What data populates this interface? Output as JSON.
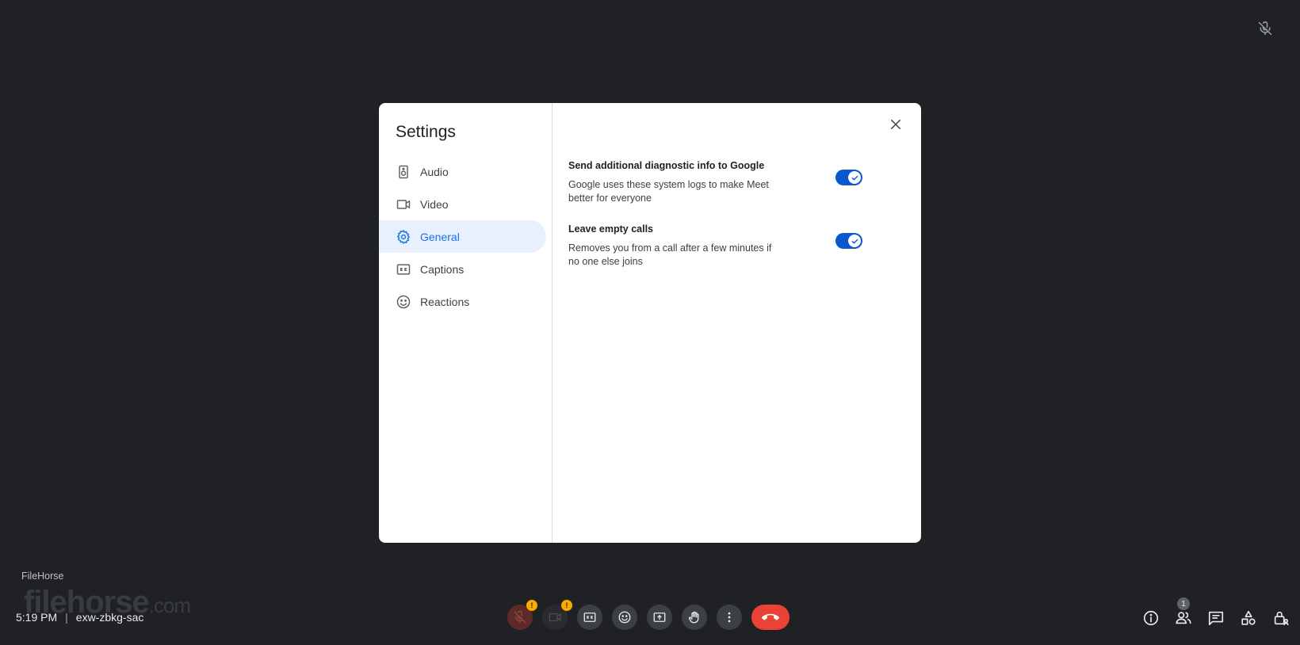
{
  "settings_dialog": {
    "title": "Settings",
    "nav": [
      {
        "label": "Audio",
        "icon": "speaker-icon",
        "active": false
      },
      {
        "label": "Video",
        "icon": "videocam-icon",
        "active": false
      },
      {
        "label": "General",
        "icon": "gear-icon",
        "active": true
      },
      {
        "label": "Captions",
        "icon": "closed-caption-icon",
        "active": false
      },
      {
        "label": "Reactions",
        "icon": "smiley-icon",
        "active": false
      }
    ],
    "settings": [
      {
        "title": "Send additional diagnostic info to Google",
        "description": "Google uses these system logs to make Meet better for everyone",
        "enabled": true
      },
      {
        "title": "Leave empty calls",
        "description": "Removes you from a call after a few minutes if no one else joins",
        "enabled": true
      }
    ]
  },
  "watermark": {
    "label": "FileHorse",
    "logo_main": "filehorse",
    "logo_suffix": ".com"
  },
  "meeting": {
    "time": "5:19 PM",
    "separator": "|",
    "code": "exw-zbkg-sac"
  },
  "controls": {
    "mic_warning": "!",
    "camera_warning": "!",
    "people_count": "1"
  },
  "colors": {
    "background": "#202124",
    "accent": "#1a73e8",
    "toggle_on": "#0b57d0",
    "end_call": "#ea4335",
    "warning": "#f9ab00"
  }
}
